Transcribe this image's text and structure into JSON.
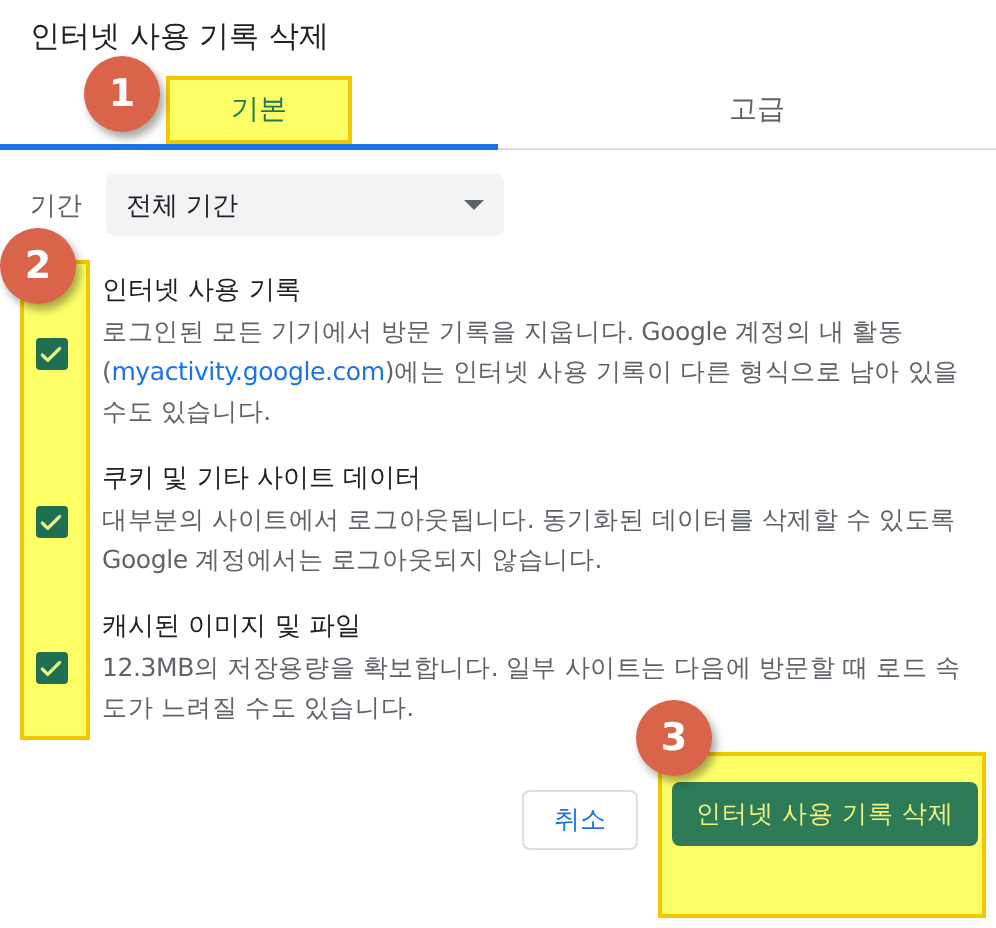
{
  "dialog": {
    "title": "인터넷 사용 기록 삭제"
  },
  "tabs": [
    {
      "label": "기본",
      "selected": true,
      "highlighted": true
    },
    {
      "label": "고급",
      "selected": false,
      "highlighted": false
    }
  ],
  "period": {
    "label": "기간",
    "value": "전체 기간"
  },
  "options_highlighted": true,
  "options": [
    {
      "title": "인터넷 사용 기록",
      "checked": true,
      "description": [
        {
          "kind": "text",
          "text": "로그인된 모든 기기에서 방문 기록을 지웁니다. Google 계정의 내 활동 ("
        },
        {
          "kind": "link",
          "text": "myactivity.google.com"
        },
        {
          "kind": "text",
          "text": ")에는 인터넷 사용 기록이 다른 형식으로 남아 있을 수도 있습니다."
        }
      ]
    },
    {
      "title": "쿠키 및 기타 사이트 데이터",
      "checked": true,
      "description": [
        {
          "kind": "text",
          "text": "대부분의 사이트에서 로그아웃됩니다. 동기화된 데이터를 삭제할 수 있도록 Google 계정에서는 로그아웃되지 않습니다."
        }
      ]
    },
    {
      "title": "캐시된 이미지 및 파일",
      "checked": true,
      "description": [
        {
          "kind": "text",
          "text": "12.3MB의 저장용량을 확보합니다. 일부 사이트는 다음에 방문할 때 로드 속도가 느려질 수도 있습니다."
        }
      ]
    }
  ],
  "buttons": [
    {
      "label": "취소",
      "kind": "secondary",
      "highlighted": false
    },
    {
      "label": "인터넷 사용 기록 삭제",
      "kind": "primary",
      "highlighted": true
    }
  ],
  "annotations": [
    {
      "number": "1"
    },
    {
      "number": "2"
    },
    {
      "number": "3"
    }
  ]
}
